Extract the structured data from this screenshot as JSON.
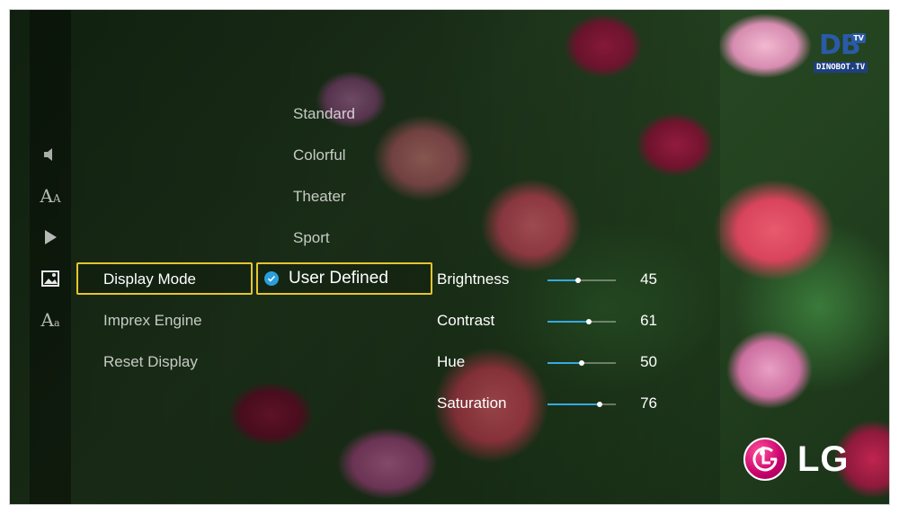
{
  "side_rail": {
    "icons": [
      "speaker-icon",
      "text-size-icon",
      "play-icon",
      "picture-icon",
      "text-settings-icon"
    ]
  },
  "category_menu": {
    "items": [
      {
        "label": "Display Mode",
        "selected": true
      },
      {
        "label": "Imprex Engine"
      },
      {
        "label": "Reset Display"
      }
    ]
  },
  "display_mode": {
    "options": [
      "Standard",
      "Colorful",
      "Theater",
      "Sport",
      "User Defined"
    ],
    "selected": "User Defined"
  },
  "adjustments": [
    {
      "label": "Brightness",
      "value": 45
    },
    {
      "label": "Contrast",
      "value": 61
    },
    {
      "label": "Hue",
      "value": 50
    },
    {
      "label": "Saturation",
      "value": 76
    }
  ],
  "watermark": {
    "big": "DB",
    "tv": "TV",
    "sub": "DINOBOT.TV"
  },
  "brand": {
    "name": "LG"
  },
  "colors": {
    "focus": "#e6c430",
    "accent": "#36a9e1",
    "check": "#2a9fdc"
  }
}
